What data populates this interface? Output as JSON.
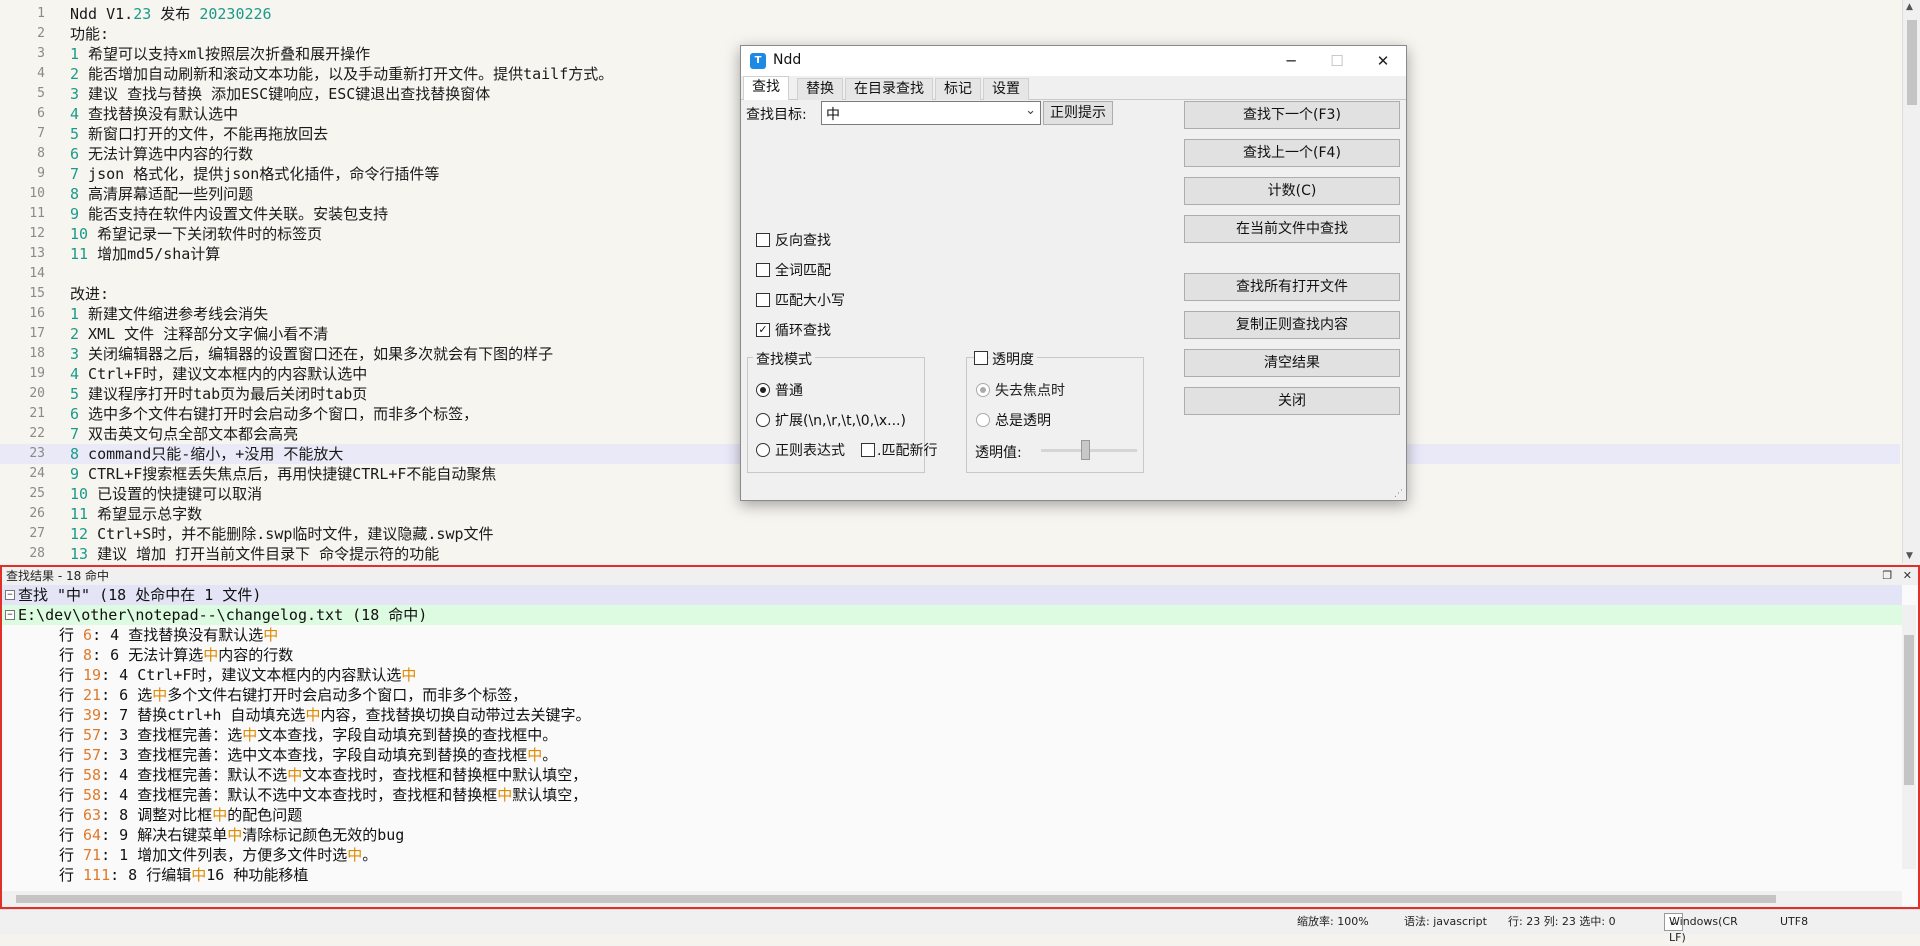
{
  "editor": {
    "lines": [
      {
        "n": "1",
        "segs": [
          {
            "t": "Ndd V1."
          },
          {
            "t": "23",
            "c": "num"
          },
          {
            "t": " 发布 "
          },
          {
            "t": "20230226",
            "c": "num"
          }
        ]
      },
      {
        "n": "2",
        "segs": [
          {
            "t": "功能:"
          }
        ]
      },
      {
        "n": "3",
        "segs": [
          {
            "t": "1",
            "c": "num"
          },
          {
            "t": " 希望可以支持xml按照层次折叠和展开操作"
          }
        ]
      },
      {
        "n": "4",
        "segs": [
          {
            "t": "2",
            "c": "num"
          },
          {
            "t": " 能否增加自动刷新和滚动文本功能，以及手动重新打开文件。提供tailf方式。"
          }
        ]
      },
      {
        "n": "5",
        "segs": [
          {
            "t": "3",
            "c": "num"
          },
          {
            "t": " 建议 查找与替换 添加ESC键响应，ESC键退出查找替换窗体"
          }
        ]
      },
      {
        "n": "6",
        "segs": [
          {
            "t": "4",
            "c": "num"
          },
          {
            "t": " 查找替换没有默认选中"
          }
        ]
      },
      {
        "n": "7",
        "segs": [
          {
            "t": "5",
            "c": "num"
          },
          {
            "t": " 新窗口打开的文件，不能再拖放回去"
          }
        ]
      },
      {
        "n": "8",
        "segs": [
          {
            "t": "6",
            "c": "num"
          },
          {
            "t": " 无法计算选中内容的行数"
          }
        ]
      },
      {
        "n": "9",
        "segs": [
          {
            "t": "7",
            "c": "num"
          },
          {
            "t": " json 格式化，提供json格式化插件，命令行插件等"
          }
        ]
      },
      {
        "n": "10",
        "segs": [
          {
            "t": "8",
            "c": "num"
          },
          {
            "t": " 高清屏幕适配一些列问题"
          }
        ]
      },
      {
        "n": "11",
        "segs": [
          {
            "t": "9",
            "c": "num"
          },
          {
            "t": " 能否支持在软件内设置文件关联。安装包支持"
          }
        ]
      },
      {
        "n": "12",
        "segs": [
          {
            "t": "10",
            "c": "num"
          },
          {
            "t": " 希望记录一下关闭软件时的标签页"
          }
        ]
      },
      {
        "n": "13",
        "segs": [
          {
            "t": "11",
            "c": "num"
          },
          {
            "t": " 增加md5/sha计算"
          }
        ]
      },
      {
        "n": "14",
        "segs": []
      },
      {
        "n": "15",
        "segs": [
          {
            "t": "改进:"
          }
        ]
      },
      {
        "n": "16",
        "segs": [
          {
            "t": "1",
            "c": "num"
          },
          {
            "t": " 新建文件缩进参考线会消失"
          }
        ]
      },
      {
        "n": "17",
        "segs": [
          {
            "t": "2",
            "c": "num"
          },
          {
            "t": " XML 文件 注释部分文字偏小看不清"
          }
        ]
      },
      {
        "n": "18",
        "segs": [
          {
            "t": "3",
            "c": "num"
          },
          {
            "t": " 关闭编辑器之后，编辑器的设置窗口还在，如果多次就会有下图的样子"
          }
        ]
      },
      {
        "n": "19",
        "segs": [
          {
            "t": "4",
            "c": "num"
          },
          {
            "t": " Ctrl+F时，建议文本框内的内容默认选中"
          }
        ]
      },
      {
        "n": "20",
        "segs": [
          {
            "t": "5",
            "c": "num"
          },
          {
            "t": " 建议程序打开时tab页为最后关闭时tab页"
          }
        ]
      },
      {
        "n": "21",
        "segs": [
          {
            "t": "6",
            "c": "num"
          },
          {
            "t": " 选中多个文件右键打开时会启动多个窗口，而非多个标签，"
          }
        ]
      },
      {
        "n": "22",
        "segs": [
          {
            "t": "7",
            "c": "num"
          },
          {
            "t": " 双击英文句点全部文本都会高亮"
          }
        ]
      },
      {
        "n": "23",
        "segs": [
          {
            "t": "8",
            "c": "num"
          },
          {
            "t": " command只能-缩小，+没用 不能放大"
          }
        ],
        "cur": true
      },
      {
        "n": "24",
        "segs": [
          {
            "t": "9",
            "c": "num"
          },
          {
            "t": " CTRL+F搜索框丢失焦点后，再用快捷键CTRL+F不能自动聚焦"
          }
        ]
      },
      {
        "n": "25",
        "segs": [
          {
            "t": "10",
            "c": "num"
          },
          {
            "t": " 已设置的快捷键可以取消"
          }
        ]
      },
      {
        "n": "26",
        "segs": [
          {
            "t": "11",
            "c": "num"
          },
          {
            "t": " 希望显示总字数"
          }
        ]
      },
      {
        "n": "27",
        "segs": [
          {
            "t": "12",
            "c": "num"
          },
          {
            "t": " Ctrl+S时，并不能删除.swp临时文件，建议隐藏.swp文件"
          }
        ]
      },
      {
        "n": "28",
        "segs": [
          {
            "t": "13",
            "c": "num"
          },
          {
            "t": " 建议 增加 打开当前文件目录下 命令提示符的功能"
          }
        ]
      }
    ]
  },
  "results": {
    "title": "查找结果 - 18 命中",
    "header": "查找 \"中\" (18 处命中在 1 文件)",
    "file": "E:\\dev\\other\\notepad--\\changelog.txt (18 命中)",
    "row_prefix": "行 ",
    "hits": [
      {
        "line": "6",
        "rest": ": 4 ",
        "before": "查找替换没有默认选",
        "hit": "中",
        "after": ""
      },
      {
        "line": "8",
        "rest": ": 6 ",
        "before": "无法计算选",
        "hit": "中",
        "after": "内容的行数"
      },
      {
        "line": "19",
        "rest": ": 4 ",
        "before": "Ctrl+F时，建议文本框内的内容默认选",
        "hit": "中",
        "after": ""
      },
      {
        "line": "21",
        "rest": ": 6 ",
        "before": "选",
        "hit": "中",
        "after": "多个文件右键打开时会启动多个窗口，而非多个标签，"
      },
      {
        "line": "39",
        "rest": ": 7 ",
        "before": "替换ctrl+h 自动填充选",
        "hit": "中",
        "after": "内容，查找替换切换自动带过去关键字。"
      },
      {
        "line": "57",
        "rest": ": 3 ",
        "before": "查找框完善：选",
        "hit": "中",
        "after": "文本查找，字段自动填充到替换的查找框中。"
      },
      {
        "line": "57",
        "rest": ": 3 ",
        "before": "查找框完善：选中文本查找，字段自动填充到替换的查找框",
        "hit": "中",
        "after": "。"
      },
      {
        "line": "58",
        "rest": ": 4 ",
        "before": "查找框完善：默认不选",
        "hit": "中",
        "after": "文本查找时，查找框和替换框中默认填空，"
      },
      {
        "line": "58",
        "rest": ": 4 ",
        "before": "查找框完善：默认不选中文本查找时，查找框和替换框",
        "hit": "中",
        "after": "默认填空，"
      },
      {
        "line": "63",
        "rest": ": 8 ",
        "before": "调整对比框",
        "hit": "中",
        "after": "的配色问题"
      },
      {
        "line": "64",
        "rest": ": 9 ",
        "before": "解决右键菜单",
        "hit": "中",
        "after": "清除标记颜色无效的bug"
      },
      {
        "line": "71",
        "rest": ": 1 ",
        "before": "增加文件列表，方便多文件时选",
        "hit": "中",
        "after": "。"
      },
      {
        "line": "111",
        "rest": ": 8 ",
        "before": " 行编辑",
        "hit": "中",
        "after": "16 种功能移植"
      }
    ]
  },
  "status": {
    "zoom": "缩放率: 100%",
    "lang": "语法: javascript",
    "pos": "行: 23 列: 23 选中: 0",
    "eol": "Windows(CR LF)",
    "enc": "UTF8"
  },
  "dialog": {
    "title": "Ndd",
    "logo": "T",
    "tabs": [
      "查找",
      "替换",
      "在目录查找",
      "标记",
      "设置"
    ],
    "find_label": "查找目标:",
    "find_value": "中",
    "regex_hint": "正则提示",
    "buttons": [
      "查找下一个(F3)",
      "查找上一个(F4)",
      "计数(C)",
      "在当前文件中查找",
      "查找所有打开文件",
      "复制正则查找内容",
      "清空结果",
      "关闭"
    ],
    "options": [
      {
        "label": "反向查找",
        "checked": false
      },
      {
        "label": "全词匹配",
        "checked": false
      },
      {
        "label": "匹配大小写",
        "checked": false
      },
      {
        "label": "循环查找",
        "checked": true
      }
    ],
    "mode_group": "查找模式",
    "modes": [
      "普通",
      "扩展(\\n,\\r,\\t,\\0,\\x...)",
      "正则表达式"
    ],
    "mode_selected": 0,
    "match_newline": ".匹配新行",
    "transparency": "透明度",
    "trans_modes": [
      "失去焦点时",
      "总是透明"
    ],
    "trans_value": "透明值:"
  }
}
